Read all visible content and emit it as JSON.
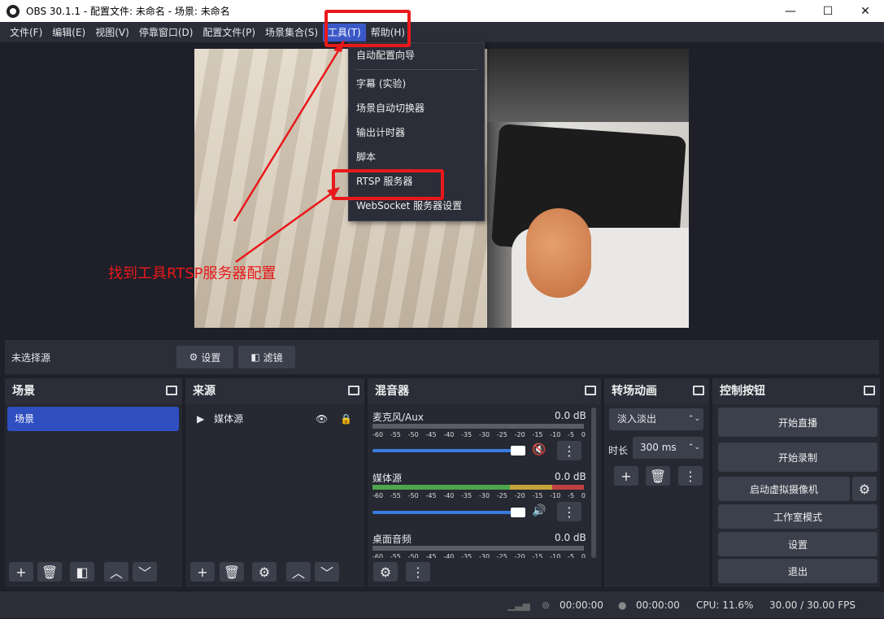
{
  "window": {
    "title": "OBS 30.1.1 - 配置文件: 未命名 - 场景: 未命名",
    "minimize": "—",
    "maximize": "☐",
    "close": "✕"
  },
  "menubar": [
    "文件(F)",
    "编辑(E)",
    "视图(V)",
    "停靠窗口(D)",
    "配置文件(P)",
    "场景集合(S)",
    "工具(T)",
    "帮助(H)"
  ],
  "tools_menu": {
    "items": [
      "自动配置向导",
      "字幕 (实验)",
      "场景自动切换器",
      "输出计时器",
      "脚本",
      "RTSP 服务器",
      "WebSocket 服务器设置"
    ]
  },
  "annotation": "找到工具RTSP服务器配置",
  "source_bar": {
    "label": "未选择源",
    "settings": "设置",
    "filters": "滤镜"
  },
  "scenes": {
    "title": "场景",
    "items": [
      "场景"
    ]
  },
  "sources": {
    "title": "来源",
    "items": [
      "媒体源"
    ]
  },
  "mixer": {
    "title": "混音器",
    "channels": [
      {
        "name": "麦克风/Aux",
        "db": "0.0 dB",
        "muted": true
      },
      {
        "name": "媒体源",
        "db": "0.0 dB",
        "muted": false
      },
      {
        "name": "桌面音频",
        "db": "0.0 dB",
        "muted": false
      }
    ],
    "ticks": [
      "-60",
      "-55",
      "-50",
      "-45",
      "-40",
      "-35",
      "-30",
      "-25",
      "-20",
      "-15",
      "-10",
      "-5",
      "0"
    ]
  },
  "transitions": {
    "title": "转场动画",
    "type": "淡入淡出",
    "duration_label": "时长",
    "duration": "300 ms"
  },
  "controls": {
    "title": "控制按钮",
    "start_stream": "开始直播",
    "start_record": "开始录制",
    "virtual_cam": "启动虚拟摄像机",
    "studio_mode": "工作室模式",
    "settings": "设置",
    "exit": "退出"
  },
  "status": {
    "stream_time": "00:00:00",
    "record_time": "00:00:00",
    "cpu": "CPU: 11.6%",
    "fps": "30.00 / 30.00 FPS"
  },
  "colors": {
    "accent": "#3a58c8",
    "annotation_red": "#e8191b",
    "panel": "#2b2e38",
    "background": "#1e1f29"
  }
}
